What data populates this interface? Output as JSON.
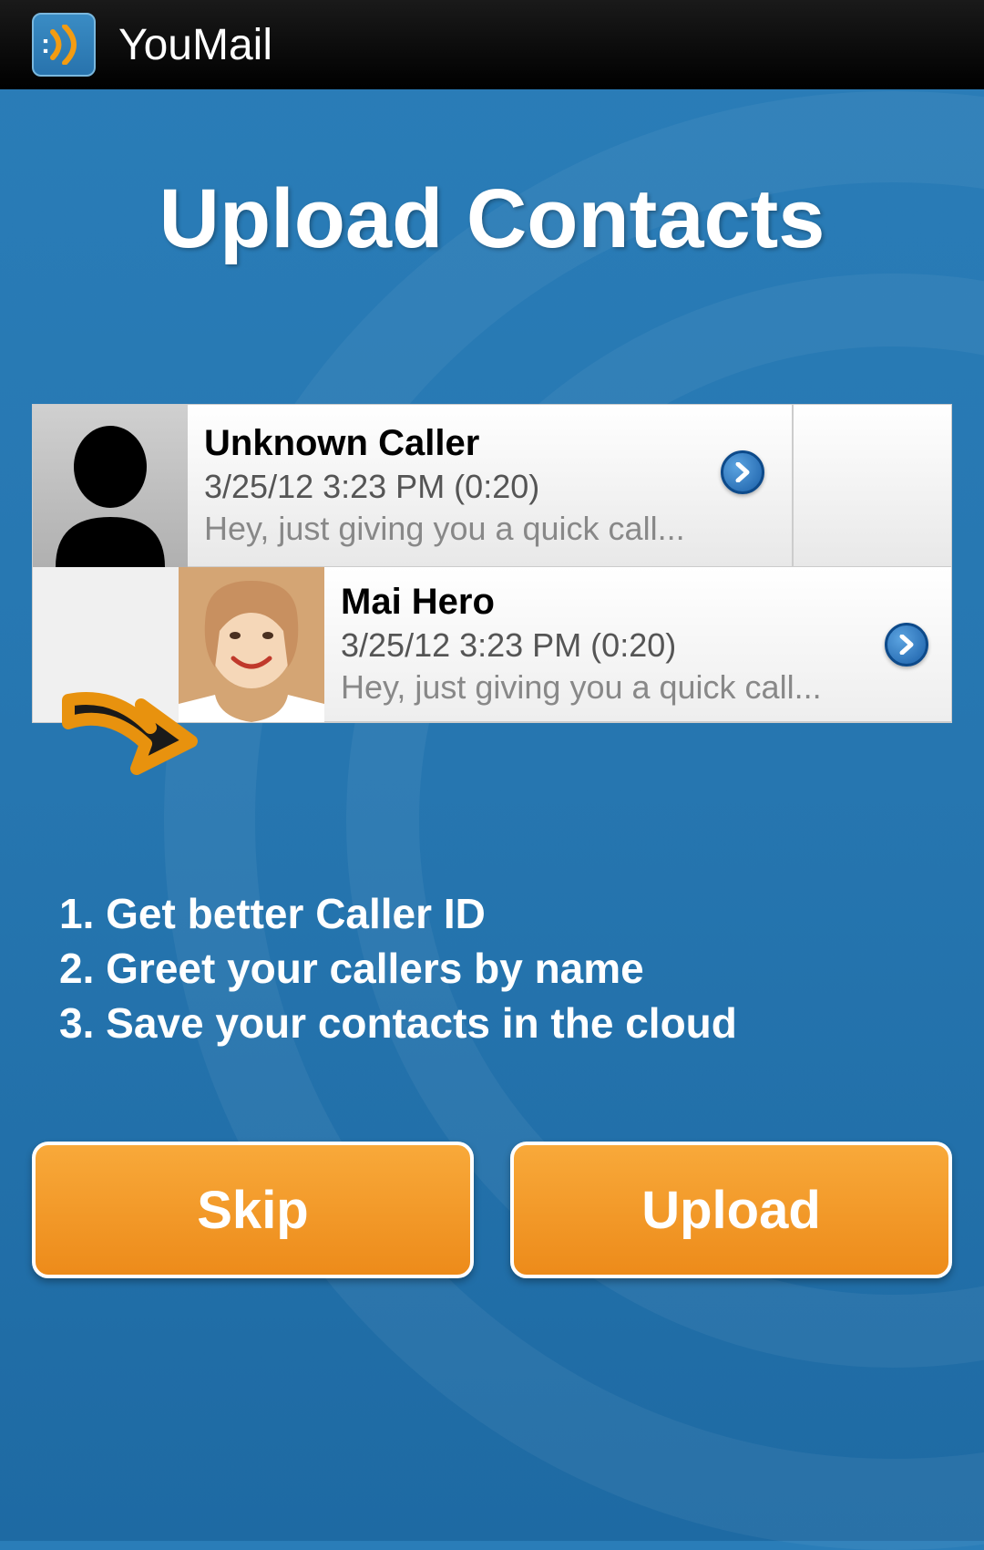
{
  "header": {
    "app_name": "YouMail"
  },
  "page": {
    "title": "Upload Contacts"
  },
  "preview": {
    "rows": [
      {
        "name": "Unknown Caller",
        "meta": "3/25/12 3:23 PM (0:20)",
        "snippet": "Hey, just giving you a quick call..."
      },
      {
        "name": "Mai Hero",
        "meta": "3/25/12 3:23 PM (0:20)",
        "snippet": "Hey, just giving you a quick call..."
      }
    ]
  },
  "benefits": {
    "item1": "1. Get better Caller ID",
    "item2": "2. Greet your callers by name",
    "item3": "3. Save your contacts in the cloud"
  },
  "buttons": {
    "skip": "Skip",
    "upload": "Upload"
  },
  "colors": {
    "accent": "#ed8b1a",
    "background": "#2676b0"
  }
}
